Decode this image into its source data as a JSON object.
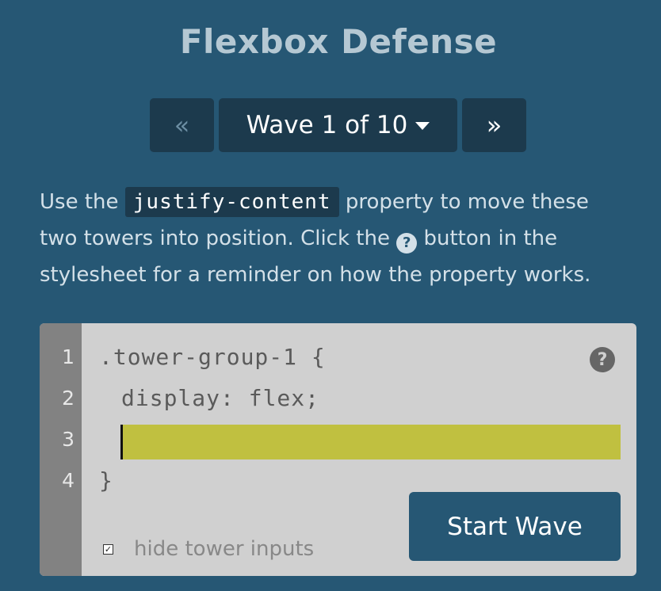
{
  "header": {
    "title": "Flexbox Defense"
  },
  "nav": {
    "prev_label": "«",
    "wave_label": "Wave 1 of 10",
    "next_label": "»"
  },
  "instructions": {
    "part1": "Use the ",
    "code": "justify-content",
    "part2": " property to move these two towers into position. Click the ",
    "help_glyph": "?",
    "part3": " button in the stylesheet for a reminder on how the property works."
  },
  "editor": {
    "line_numbers": [
      "1",
      "2",
      "3",
      "4"
    ],
    "line1": ".tower-group-1 {",
    "line2": "display: flex;",
    "input_value": "",
    "line4": "}",
    "help_glyph": "?",
    "start_button": "Start Wave",
    "hide_inputs_label": "hide tower inputs",
    "hide_inputs_checked": true,
    "checkbox_glyph": "✓"
  },
  "colors": {
    "background": "#265774",
    "nav_button": "#1c3a4d",
    "input_highlight": "#c0c040",
    "editor_bg": "#d0d0d0",
    "gutter": "#828282"
  }
}
